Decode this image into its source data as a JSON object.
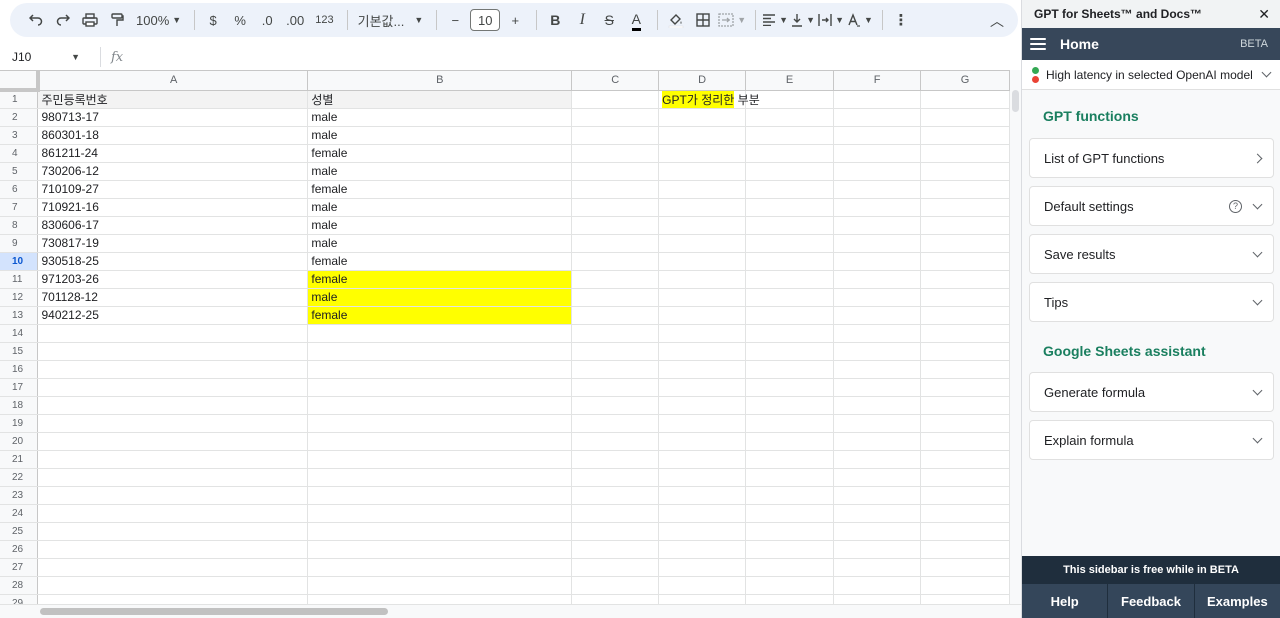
{
  "toolbar": {
    "zoom": "100%",
    "currency": "$",
    "percent": "%",
    "dec_decrease": ".0",
    "dec_increase": ".00",
    "number_format": "123",
    "font": "기본값...",
    "font_size": "10",
    "minus": "−",
    "plus": "+",
    "bold": "B",
    "italic": "I",
    "strike": "S",
    "text_color": "A",
    "more": "⋮",
    "collapse": "︿"
  },
  "formula_bar": {
    "name_box": "J10",
    "fx": "fx"
  },
  "columns": [
    "A",
    "B",
    "C",
    "D",
    "E",
    "F",
    "G"
  ],
  "active_row": 10,
  "rows": [
    {
      "n": "1",
      "a": "주민등록번호",
      "b": "성별",
      "hl": false,
      "header": true
    },
    {
      "n": "2",
      "a": "980713-17",
      "b": "male",
      "hl": false
    },
    {
      "n": "3",
      "a": "860301-18",
      "b": "male",
      "hl": false
    },
    {
      "n": "4",
      "a": "861211-24",
      "b": "female",
      "hl": false
    },
    {
      "n": "5",
      "a": "730206-12",
      "b": "male",
      "hl": false
    },
    {
      "n": "6",
      "a": "710109-27",
      "b": "female",
      "hl": false
    },
    {
      "n": "7",
      "a": "710921-16",
      "b": "male",
      "hl": false
    },
    {
      "n": "8",
      "a": "830606-17",
      "b": "male",
      "hl": false
    },
    {
      "n": "9",
      "a": "730817-19",
      "b": "male",
      "hl": false
    },
    {
      "n": "10",
      "a": "930518-25",
      "b": "female",
      "hl": false
    },
    {
      "n": "11",
      "a": "971203-26",
      "b": "female",
      "hl": true
    },
    {
      "n": "12",
      "a": "701128-12",
      "b": "male",
      "hl": true
    },
    {
      "n": "13",
      "a": "940212-25",
      "b": "female",
      "hl": true
    },
    {
      "n": "14",
      "a": "",
      "b": "",
      "hl": false
    },
    {
      "n": "15",
      "a": "",
      "b": "",
      "hl": false
    },
    {
      "n": "16",
      "a": "",
      "b": "",
      "hl": false
    },
    {
      "n": "17",
      "a": "",
      "b": "",
      "hl": false
    },
    {
      "n": "18",
      "a": "",
      "b": "",
      "hl": false
    },
    {
      "n": "19",
      "a": "",
      "b": "",
      "hl": false
    },
    {
      "n": "20",
      "a": "",
      "b": "",
      "hl": false
    },
    {
      "n": "21",
      "a": "",
      "b": "",
      "hl": false
    },
    {
      "n": "22",
      "a": "",
      "b": "",
      "hl": false
    },
    {
      "n": "23",
      "a": "",
      "b": "",
      "hl": false
    },
    {
      "n": "24",
      "a": "",
      "b": "",
      "hl": false
    },
    {
      "n": "25",
      "a": "",
      "b": "",
      "hl": false
    },
    {
      "n": "26",
      "a": "",
      "b": "",
      "hl": false
    },
    {
      "n": "27",
      "a": "",
      "b": "",
      "hl": false
    },
    {
      "n": "28",
      "a": "",
      "b": "",
      "hl": false
    },
    {
      "n": "29",
      "a": "",
      "b": "",
      "hl": false
    }
  ],
  "d1_note": {
    "highlighted": "GPT가 정리한",
    "rest": " 부분"
  },
  "colors": {
    "highlight": "#ffff00",
    "accent_green": "#1a7f5f",
    "nav_bg": "#37475a",
    "footer_bg": "#1f2e3d"
  },
  "sidebar": {
    "title": "GPT for Sheets™ and Docs™",
    "close": "✕",
    "nav_home": "Home",
    "nav_beta": "BETA",
    "latency": "High latency in selected OpenAI model",
    "section1": "GPT functions",
    "list_functions": "List of GPT functions",
    "default_settings": "Default settings",
    "help": "?",
    "save_results": "Save results",
    "tips": "Tips",
    "section2": "Google Sheets assistant",
    "generate_formula": "Generate formula",
    "explain_formula": "Explain formula",
    "footer_note": "This sidebar is free while in BETA",
    "footer_help": "Help",
    "footer_feedback": "Feedback",
    "footer_examples": "Examples"
  }
}
